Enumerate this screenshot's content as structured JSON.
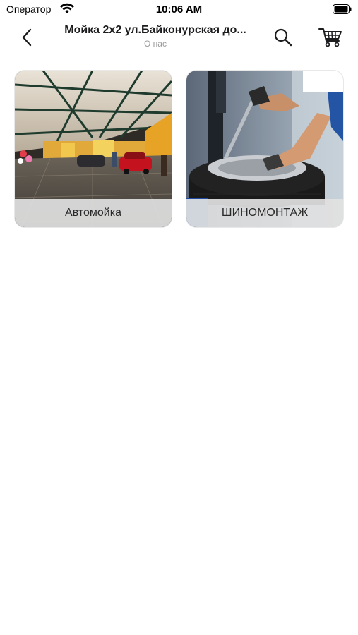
{
  "status_bar": {
    "carrier": "Оператор",
    "time": "10:06 AM",
    "icons": [
      "wifi-icon",
      "battery-icon"
    ]
  },
  "nav": {
    "title": "Мойка 2х2 ул.Байконурская до...",
    "subtitle": "О нас",
    "icons": [
      "chevron-left-icon",
      "search-icon",
      "cart-icon"
    ]
  },
  "tiles": [
    {
      "label": "Автомойка"
    },
    {
      "label": "ШИНОМОНТАЖ"
    }
  ],
  "colors": {
    "background": "#ffffff",
    "label_bg": "#e1e1e1",
    "subtitle": "#9a9a9a",
    "divider": "#e6e6e6"
  }
}
